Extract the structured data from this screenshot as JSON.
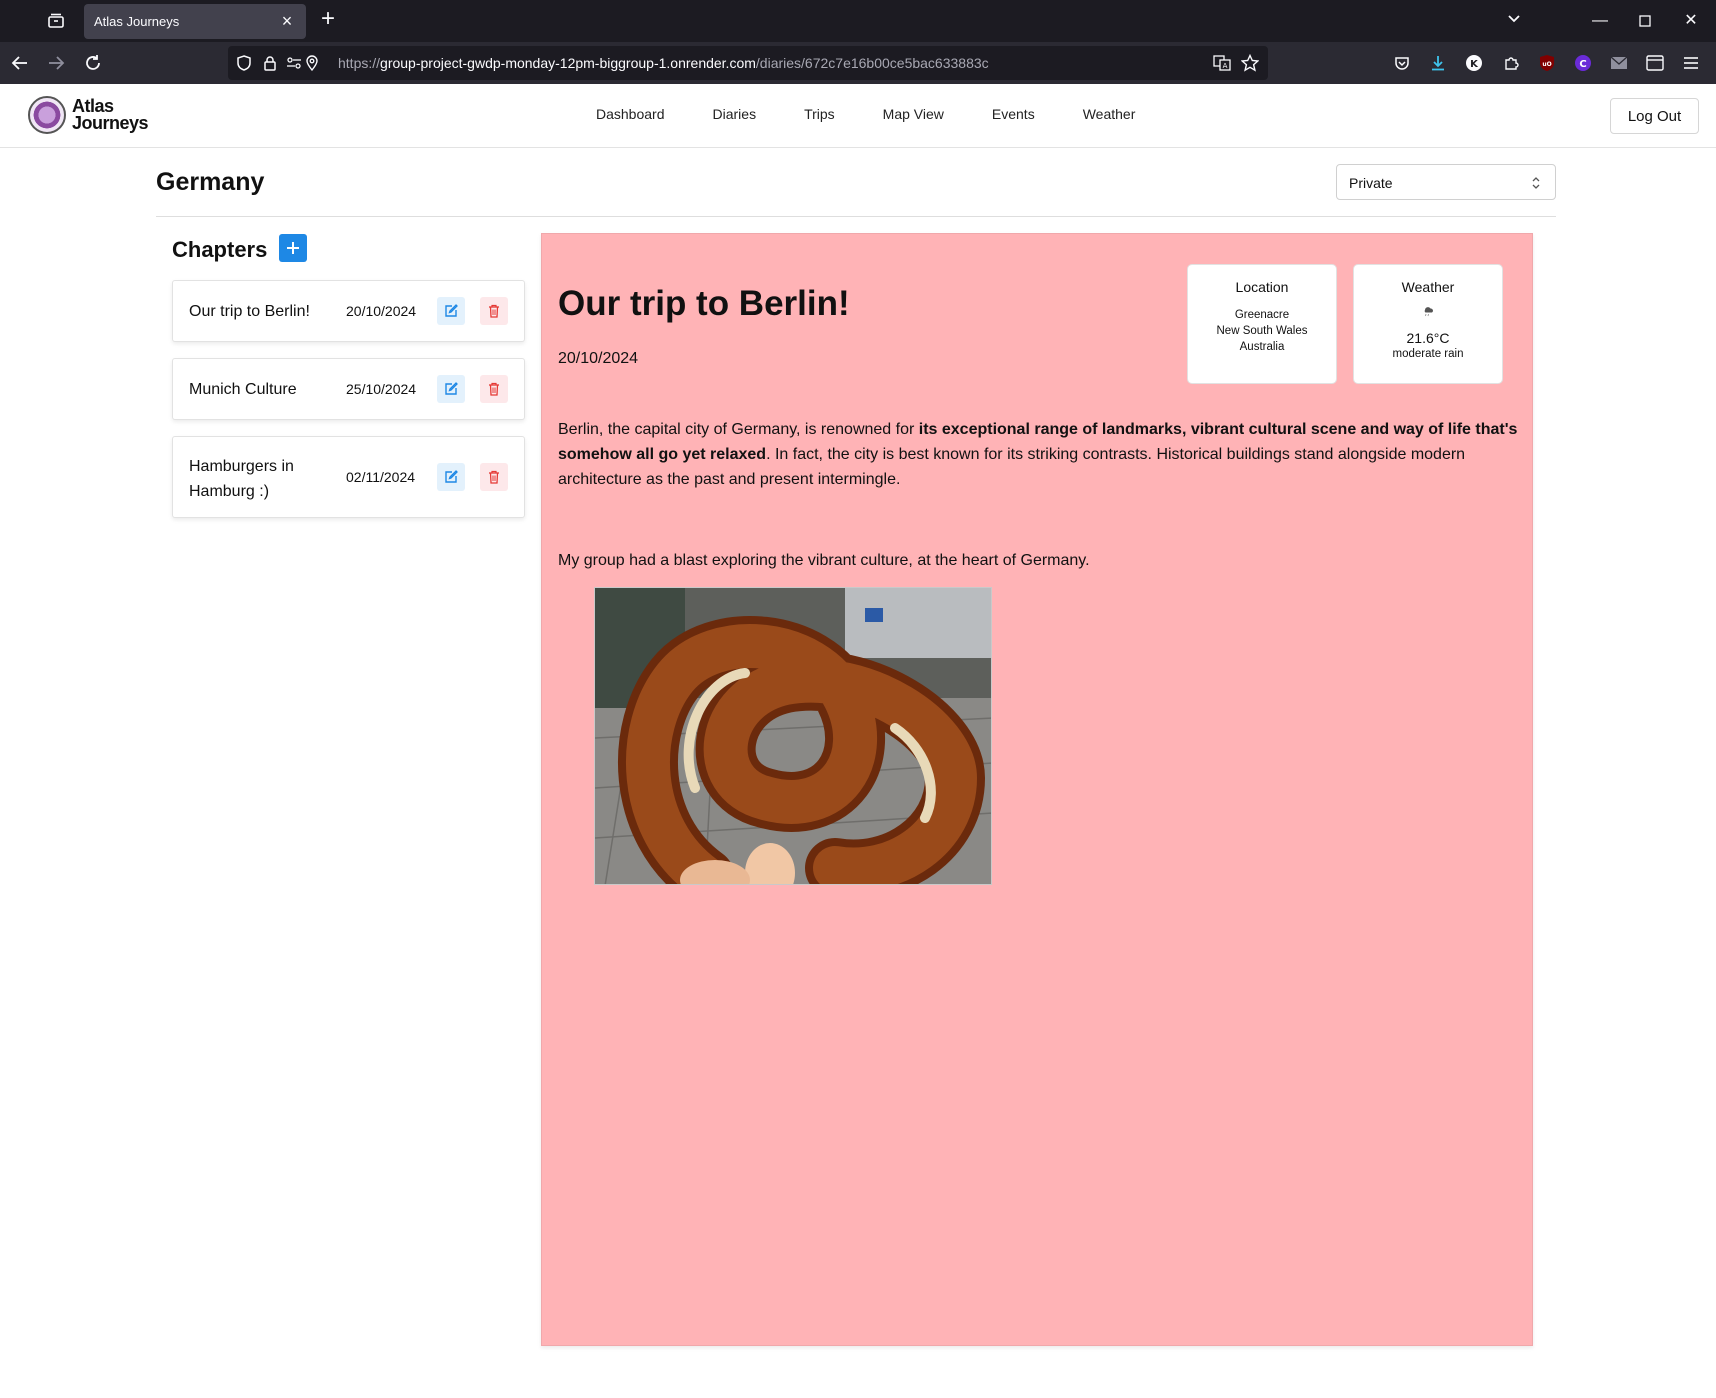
{
  "browser": {
    "tab_title": "Atlas Journeys",
    "url_scheme": "https://",
    "url_host": "group-project-gwdp-monday-12pm-biggroup-1.onrender.com",
    "url_path": "/diaries/672c7e16b00ce5bac633883c"
  },
  "app": {
    "logo_line1": "Atlas",
    "logo_line2": "Journeys",
    "nav": [
      "Dashboard",
      "Diaries",
      "Trips",
      "Map View",
      "Events",
      "Weather"
    ],
    "logout_label": "Log Out"
  },
  "diary": {
    "title": "Germany",
    "visibility": "Private"
  },
  "chapters": {
    "heading": "Chapters",
    "items": [
      {
        "name": "Our trip to Berlin!",
        "date": "20/10/2024"
      },
      {
        "name": "Munich Culture",
        "date": "25/10/2024"
      },
      {
        "name": "Hamburgers in Hamburg :)",
        "date": "02/11/2024"
      }
    ]
  },
  "entry": {
    "title": "Our trip to Berlin!",
    "date": "20/10/2024",
    "location": {
      "label": "Location",
      "suburb": "Greenacre",
      "state": "New South Wales",
      "country": "Australia"
    },
    "weather": {
      "label": "Weather",
      "temperature": "21.6°C",
      "condition": "moderate rain",
      "icon": "rain-cloud-icon"
    },
    "para1_a": "Berlin, the capital city of Germany, is renowned for ",
    "para1_bold": "its exceptional range of landmarks, vibrant cultural scene and way of life that's somehow all go yet relaxed",
    "para1_b": ". In fact, the city is best known for its striking contrasts. Historical buildings stand alongside modern architecture as the past and present intermingle.",
    "para2": "My group had a blast exploring the vibrant culture, at the heart of Germany."
  },
  "colors": {
    "panel_bg": "#ffb3b6",
    "accent_blue": "#1e88e5",
    "danger_red": "#e53935"
  }
}
